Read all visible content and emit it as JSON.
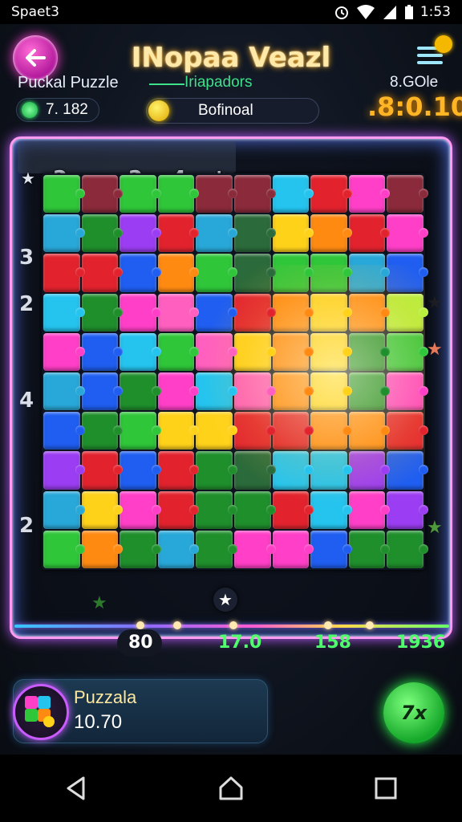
{
  "status_bar": {
    "carrier": "Spaet3",
    "time": "1:53"
  },
  "header": {
    "title": "INopaa Veazl"
  },
  "info": {
    "left_label": "Puckal Puzzle",
    "mid_label": "Iriapadors",
    "right_label": "8.GOle",
    "left_value": "7. 182",
    "mid_value": "Bofinoal",
    "timer": ".8:0.10"
  },
  "board": {
    "top_numbers": [
      "2",
      "2",
      "4"
    ],
    "side_numbers": [
      "3",
      "2",
      "4",
      "2"
    ],
    "colors": {
      "r": "#e2232e",
      "o": "#ff8a12",
      "y": "#ffd21a",
      "g": "#2fc63a",
      "G": "#1f8f2c",
      "c": "#24c4ef",
      "b": "#1f5ef0",
      "p": "#9b3df2",
      "m": "#ff3fc7",
      "d": "#ff5fbf",
      "t": "#28a8d8",
      "l": "#b8ef3c",
      "k": "#8a2a3a",
      "n": "#2b6a3a"
    },
    "rows": [
      "gkggkkcrmk",
      "tGprtnyorm",
      "rrbognggtb",
      "cGmdbroyol",
      "mbcgdyoyGg",
      "tbGmcdoyGm",
      "bGgyyrroor",
      "prbrGnccpb",
      "tymrGGrcmp",
      "goGtGmmbGG"
    ]
  },
  "progress": {
    "scores": [
      "80",
      "17.0",
      "158",
      "1936"
    ],
    "level": 0.72
  },
  "player": {
    "name": "Puzzala",
    "score": "10.70"
  },
  "play_button": {
    "label": "7x"
  }
}
